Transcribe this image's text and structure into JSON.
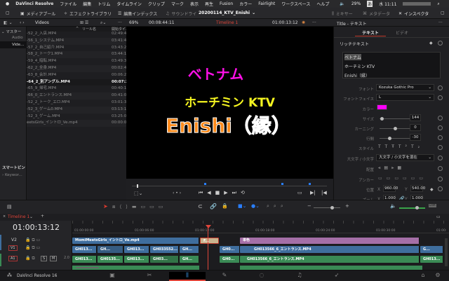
{
  "menubar": {
    "apple": "",
    "app": "DaVinci Resolve",
    "items": [
      "ファイル",
      "編集",
      "トリム",
      "タイムライン",
      "クリップ",
      "マーク",
      "表示",
      "再生",
      "Fusion",
      "カラー",
      "Fairlight",
      "ワークスペース",
      "ヘルプ"
    ],
    "battery": "29%",
    "input": "あ",
    "clock": "水 11:11"
  },
  "toolbar": {
    "media_pool": "メディアプール",
    "effects": "エフェクトライブラリ",
    "edit_index": "編集インデックス",
    "sound": "サウンドライ",
    "project": "20200114_KTV_Enishi",
    "mixer": "ミキサー",
    "metadata": "メタデータ",
    "inspector": "インスペクタ"
  },
  "mediapool": {
    "bin_title": "Videos",
    "master": "マスター",
    "bins": [
      "Audio",
      "Vide..."
    ],
    "smart_bins": "スマートビン",
    "keywords": "Keywor...",
    "columns": {
      "reel": "リール名",
      "start": "開始タイム"
    },
    "clips": [
      {
        "name": "-52_2_入店.MP4",
        "start": "02:49:4"
      },
      {
        "name": "-56_1_システム.MP4",
        "start": "03:41:4"
      },
      {
        "name": "-57_2_自己紹介.MP4",
        "start": "03:43:2"
      },
      {
        "name": "-58_2_トーク1.MP4",
        "start": "03:44:1"
      },
      {
        "name": "-59_4_暗転.MP4",
        "start": "03:49:3"
      },
      {
        "name": "-62_2_全身.MP4",
        "start": "00:02:4"
      },
      {
        "name": "-63_8_会計.MP4",
        "start": "00:06:2"
      },
      {
        "name": "-64_2_別アングル.MP4",
        "start": "00:07:2"
      },
      {
        "name": "-65_9_帰宅.MP4",
        "start": "00:40:1"
      },
      {
        "name": "-66_0_エントランス.MP4",
        "start": "00:41:0"
      },
      {
        "name": "-52_2_トーク_エロ.MP4",
        "start": "03:01:3"
      },
      {
        "name": "-52_3_ゲーム0.MP4",
        "start": "03:13:1"
      },
      {
        "name": "-52_3_ゲーム.MP4",
        "start": "03:25:0"
      },
      {
        "name": "eetsGirls_イントロ_Ve.mp4",
        "start": "00:00:0"
      }
    ]
  },
  "viewer": {
    "zoom": "69%",
    "source_tc": "00:08:44:11",
    "timeline_name": "Timeline 1",
    "record_tc": "01:00:13:12",
    "title_lines": [
      {
        "text": "ベトナム",
        "color": "#ff10e8"
      },
      {
        "text": "ホーチミン KTV",
        "color": "#f5f520"
      },
      {
        "text": "Enishi（縁）",
        "color": "#ff8a1a"
      }
    ]
  },
  "inspector": {
    "header": "Title - テキスト",
    "tabs": [
      "テキスト",
      "ビデオ"
    ],
    "section": "リッチテキスト",
    "text_lines": [
      "ベトナム",
      "ホーチミン KTV",
      "Enishi（縁）"
    ],
    "font_label": "フォント",
    "font": "Kozuka Gothic Pro",
    "face_label": "フォントフェイス",
    "face": "L",
    "color_label": "カラー",
    "color": "#ff00ff",
    "size_label": "サイズ",
    "size": "144",
    "kerning_label": "カーニング",
    "kerning": "0",
    "leading_label": "行間",
    "leading": "-30",
    "style_label": "スタイル",
    "case_label": "大文字 / 小文字",
    "case": "大文字 / 小文字を混在",
    "align_label": "配置",
    "anchor_label": "アンカー",
    "pos_label": "位置",
    "pos_x": "960.00",
    "pos_y": "540.00",
    "zoom_label": "ズーム",
    "zoom_x": "1.000",
    "zoom_y": "1.000",
    "x": "X",
    "y": "Y"
  },
  "timeline": {
    "tab": "Timeline 1",
    "timecode": "01:00:13:12",
    "ruler": [
      "01:00:00:00",
      "01:00:06:00",
      "01:00:12:00",
      "01:00:18:00",
      "01:00:24:00",
      "01:00:30:00",
      "01:00:"
    ],
    "tracks": {
      "v2": "V2",
      "v1": "V1",
      "a1": "A1",
      "a1_ch": "2.0",
      "s": "S",
      "m": "M"
    },
    "v2": [
      "MomiMeetsGirls_イントロ_Ve.mp4",
      "F...",
      "単色"
    ],
    "v1": [
      "GH013...",
      "GH...",
      "GH013...",
      "GH033552...",
      "GH...",
      "GH0...",
      "GH013566_6_エントランス.MP4",
      "G..."
    ],
    "a1": [
      "GH013...",
      "GH0135...",
      "GH013...",
      "GH03...",
      "GH...",
      "GH0...",
      "GH013566_6_エントランス.MP4",
      "GH013..."
    ],
    "dim": "DIM"
  },
  "bottom": {
    "app": "DaVinci Resolve 16"
  }
}
